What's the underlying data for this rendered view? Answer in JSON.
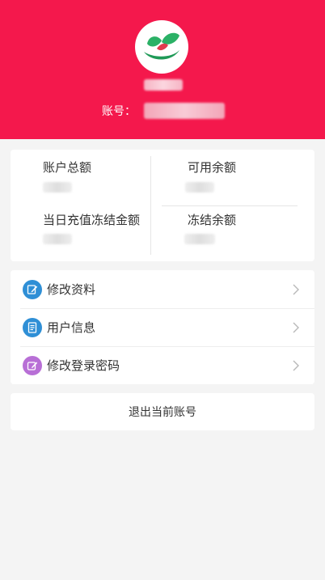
{
  "header": {
    "account_label": "账号：",
    "bg_color": "#f4184c"
  },
  "balances": {
    "total_label": "账户总额",
    "available_label": "可用余额",
    "today_frozen_label": "当日充值冻结金额",
    "frozen_label": "冻结余额"
  },
  "menu": {
    "items": [
      {
        "label": "修改资料",
        "icon": "edit-icon",
        "color": "#2f8fd6"
      },
      {
        "label": "用户信息",
        "icon": "document-icon",
        "color": "#2f8fd6"
      },
      {
        "label": "修改登录密码",
        "icon": "password-edit-icon",
        "color": "#b86fd6"
      }
    ]
  },
  "logout": {
    "label": "退出当前账号"
  }
}
